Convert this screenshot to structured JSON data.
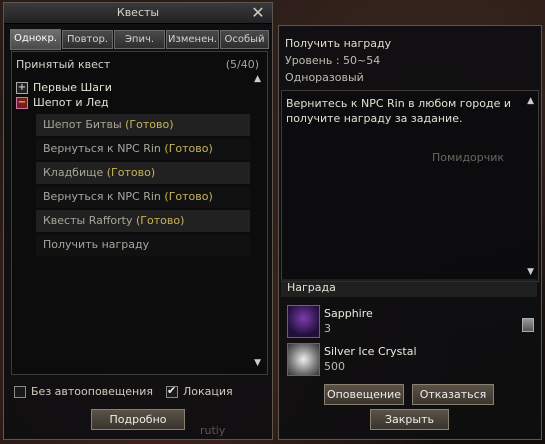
{
  "left_window": {
    "title": "Квесты",
    "tabs": [
      {
        "label": "Однокр.",
        "active": true
      },
      {
        "label": "Повтор.",
        "active": false
      },
      {
        "label": "Эпич.",
        "active": false
      },
      {
        "label": "Изменен.",
        "active": false
      },
      {
        "label": "Особый",
        "active": false
      }
    ],
    "accepted_label": "Принятый квест",
    "accepted_count": "(5/40)",
    "groups": [
      {
        "label": "Первые Шаги",
        "expanded": false
      },
      {
        "label": "Шепот и Лед",
        "expanded": true
      }
    ],
    "quests": [
      {
        "name": "Шепот Битвы",
        "status": "(Готово)"
      },
      {
        "name": "Вернуться к NPC Rin",
        "status": "(Готово)"
      },
      {
        "name": "Кладбище",
        "status": "(Готово)"
      },
      {
        "name": "Вернуться к NPC Rin",
        "status": "(Готово)"
      },
      {
        "name": "Квесты Rafforty",
        "status": "(Готово)"
      },
      {
        "name": "Получить награду",
        "status": ""
      }
    ],
    "no_notify_label": "Без автооповещения",
    "no_notify_checked": false,
    "location_label": "Локация",
    "location_checked": true,
    "details_button": "Подробно",
    "watermark": "rutiy"
  },
  "right_window": {
    "quest_title": "Получить награду",
    "level": "Уровень :  50~54",
    "type": "Одноразовый",
    "description": "Вернитесь к NPC Rin в любом городе и получите награду за задание.",
    "watermark": "Помидорчик",
    "reward_header": "Награда",
    "rewards": [
      {
        "name": "Sapphire",
        "qty": "3",
        "icon": "sapphire-icon"
      },
      {
        "name": "Silver Ice Crystal",
        "qty": "500",
        "icon": "crystal-icon"
      }
    ],
    "notify_button": "Оповещение",
    "refuse_button": "Отказаться",
    "close_button": "Закрыть"
  }
}
